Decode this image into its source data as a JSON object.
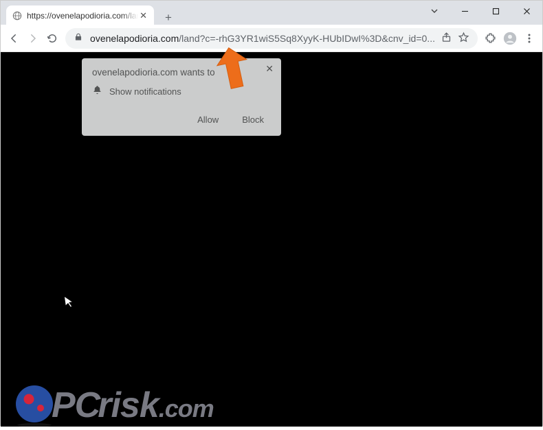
{
  "tab": {
    "title": "https://ovenelapodioria.com/land"
  },
  "address": {
    "domain": "ovenelapodioria.com",
    "path": "/land?c=-rhG3YR1wiS5Sq8XyyK-HUbIDwI%3D&cnv_id=0..."
  },
  "permission_dialog": {
    "title": "ovenelapodioria.com wants to",
    "item": "Show notifications",
    "allow": "Allow",
    "block": "Block"
  },
  "logo": {
    "prefix": "PC",
    "main": "risk",
    "suffix": ".com"
  }
}
